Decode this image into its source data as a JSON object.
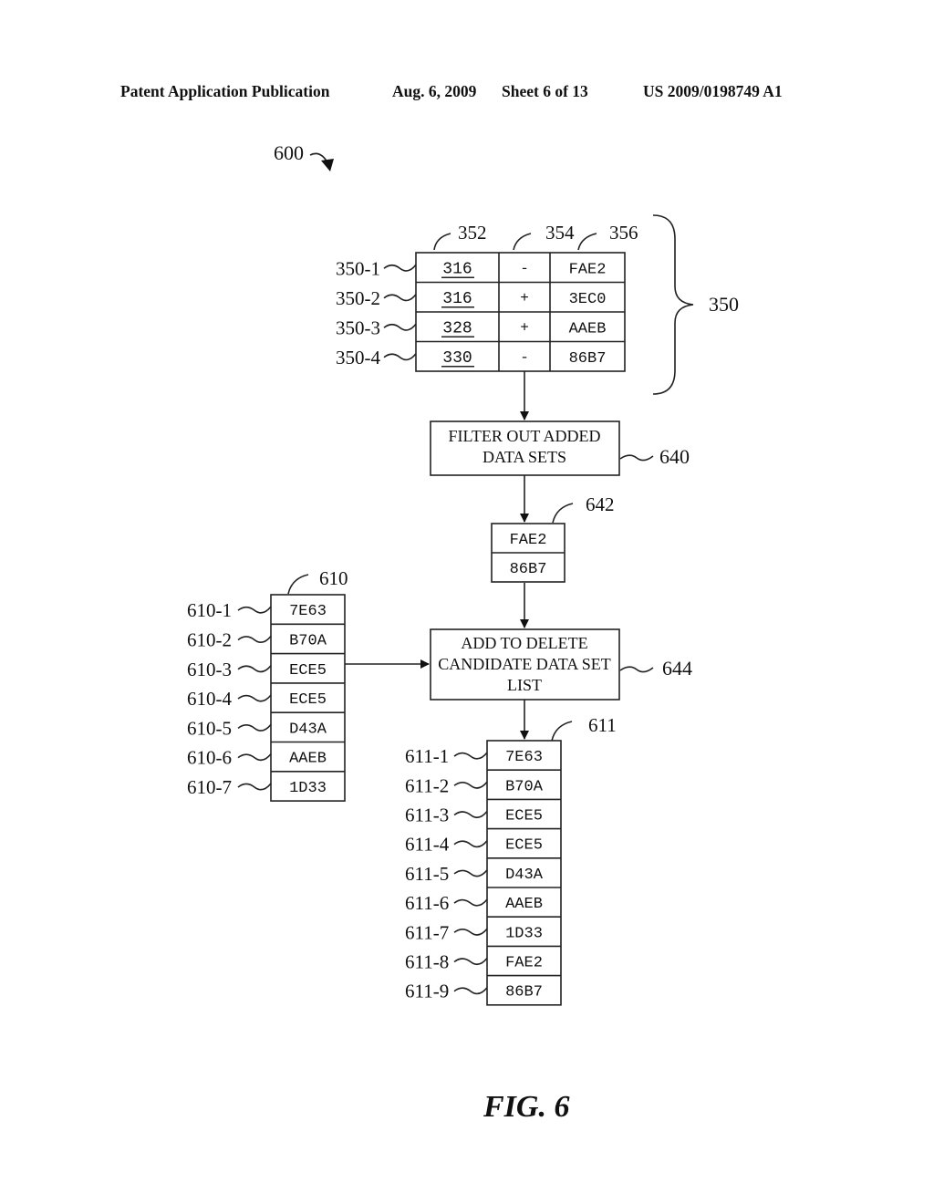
{
  "header": {
    "publication": "Patent Application Publication",
    "date": "Aug. 6, 2009",
    "sheet": "Sheet 6 of 13",
    "number": "US 2009/0198749 A1"
  },
  "figure": {
    "label": "FIG. 6",
    "ref": "600"
  },
  "table_350": {
    "ref": "350",
    "column_refs": [
      "352",
      "354",
      "356"
    ],
    "rows": [
      {
        "ref": "350-1",
        "id": "316",
        "op": "-",
        "value": "FAE2"
      },
      {
        "ref": "350-2",
        "id": "316",
        "op": "+",
        "value": "3EC0"
      },
      {
        "ref": "350-3",
        "id": "328",
        "op": "+",
        "value": "AAEB"
      },
      {
        "ref": "350-4",
        "id": "330",
        "op": "-",
        "value": "86B7"
      }
    ]
  },
  "step_640": {
    "ref": "640",
    "lines": [
      "FILTER OUT ADDED",
      "DATA SETS"
    ]
  },
  "list_642": {
    "ref": "642",
    "items": [
      "FAE2",
      "86B7"
    ]
  },
  "list_610": {
    "ref": "610",
    "items": [
      {
        "ref": "610-1",
        "value": "7E63"
      },
      {
        "ref": "610-2",
        "value": "B70A"
      },
      {
        "ref": "610-3",
        "value": "ECE5"
      },
      {
        "ref": "610-4",
        "value": "ECE5"
      },
      {
        "ref": "610-5",
        "value": "D43A"
      },
      {
        "ref": "610-6",
        "value": "AAEB"
      },
      {
        "ref": "610-7",
        "value": "1D33"
      }
    ]
  },
  "step_644": {
    "ref": "644",
    "lines": [
      "ADD TO DELETE",
      "CANDIDATE DATA SET",
      "LIST"
    ]
  },
  "list_611": {
    "ref": "611",
    "items": [
      {
        "ref": "611-1",
        "value": "7E63"
      },
      {
        "ref": "611-2",
        "value": "B70A"
      },
      {
        "ref": "611-3",
        "value": "ECE5"
      },
      {
        "ref": "611-4",
        "value": "ECE5"
      },
      {
        "ref": "611-5",
        "value": "D43A"
      },
      {
        "ref": "611-6",
        "value": "AAEB"
      },
      {
        "ref": "611-7",
        "value": "1D33"
      },
      {
        "ref": "611-8",
        "value": "FAE2"
      },
      {
        "ref": "611-9",
        "value": "86B7"
      }
    ]
  }
}
